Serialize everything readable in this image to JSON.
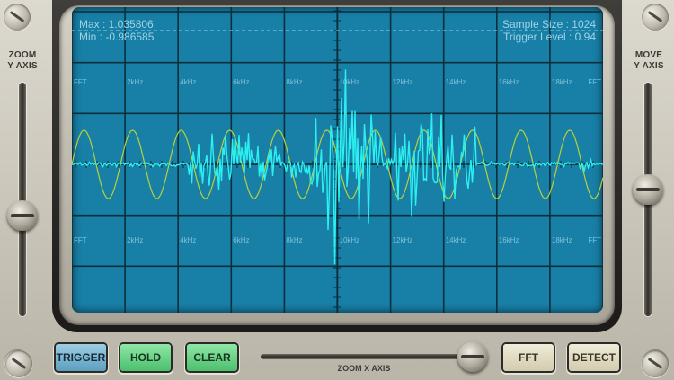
{
  "readouts": {
    "max": "Max : 1.035806",
    "min": "Min : -0.986585",
    "sample_size": "Sample Size : 1024",
    "trigger_level": "Trigger Level : 0.94"
  },
  "left_panel": {
    "label_line1": "ZOOM",
    "label_line2": "Y AXIS",
    "slider_value": 0.62
  },
  "right_panel": {
    "label_line1": "MOVE",
    "label_line2": "Y AXIS",
    "slider_value": 0.46
  },
  "fft_row_labels": [
    "FFT",
    "2kHz",
    "4kHz",
    "6kHz",
    "8kHz",
    "10kHz",
    "12kHz",
    "14kHz",
    "16kHz",
    "18kHz",
    "FFT"
  ],
  "buttons": {
    "trigger": "TRIGGER",
    "hold": "HOLD",
    "clear": "CLEAR",
    "fft": "FFT",
    "detect": "DETECT"
  },
  "zoom_x": {
    "label": "ZOOM X AXIS",
    "slider_value": 0.92
  },
  "icons": [
    "screw-icon"
  ],
  "colors": {
    "screen": "#187fa6",
    "grid": "#0b2e3c",
    "waveform": "#2cf0f0",
    "sine": "#b6d23a",
    "readout_text": "#9fd3e6"
  }
}
